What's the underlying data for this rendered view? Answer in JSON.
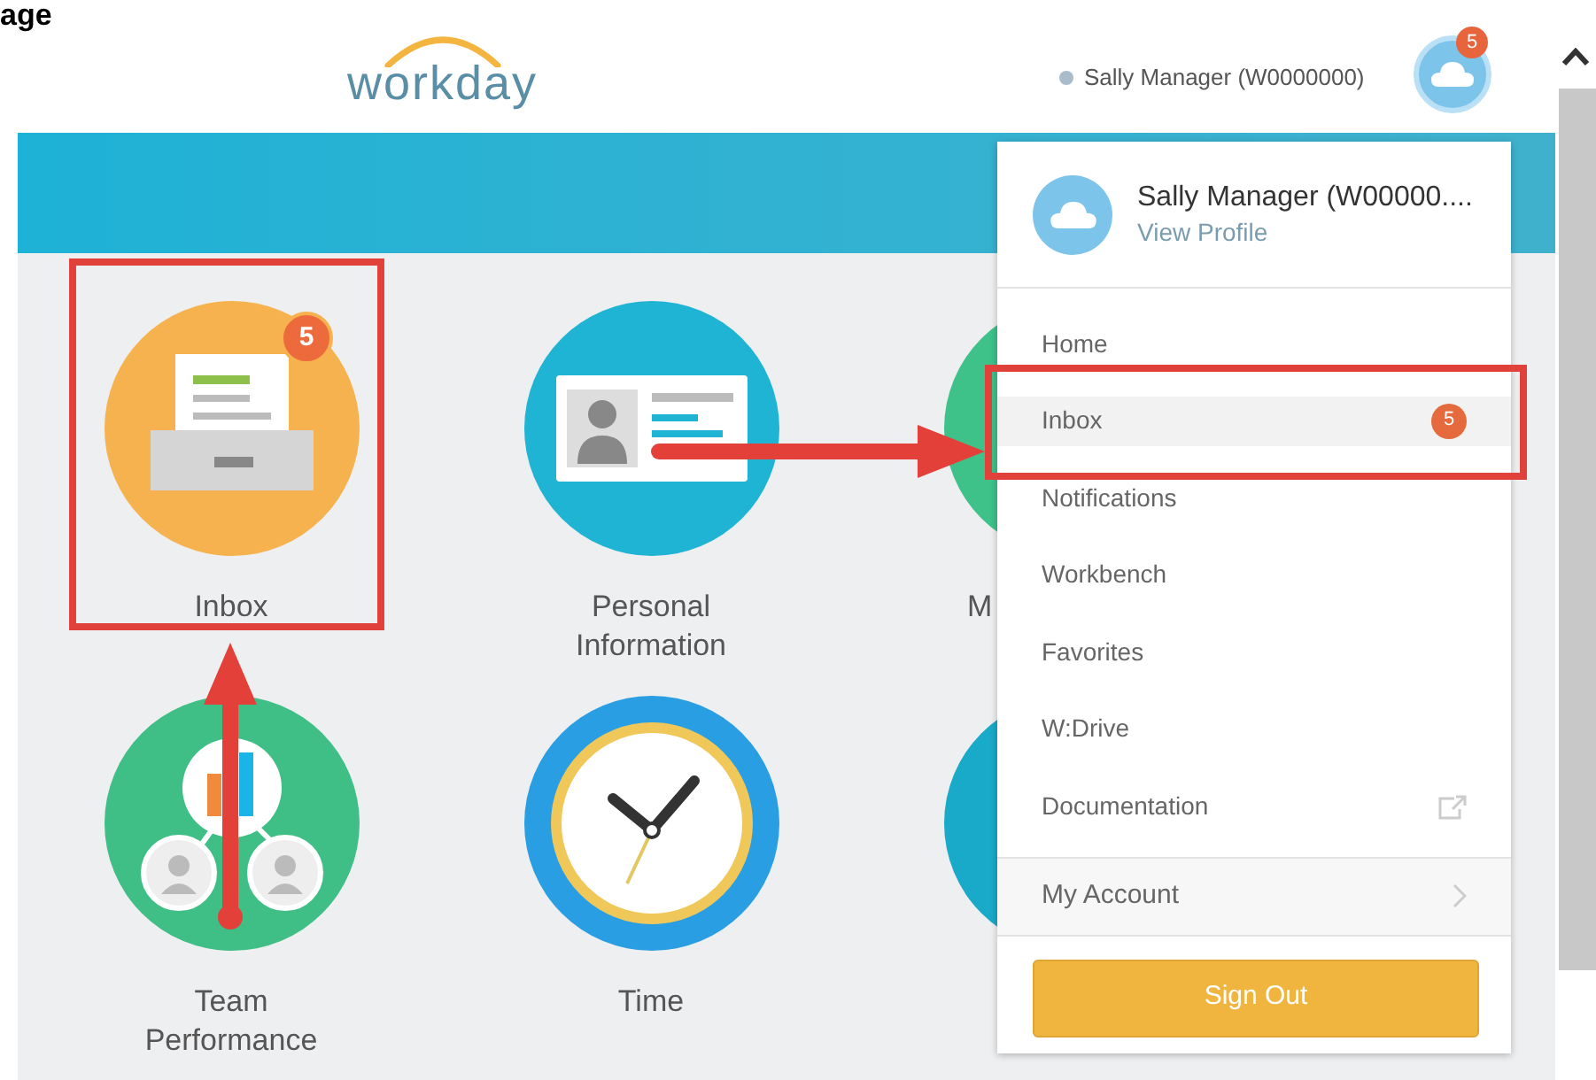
{
  "heading": "age",
  "logo": "workday",
  "user": {
    "name": "Sally Manager (W0000000)",
    "badge": "5"
  },
  "tiles": [
    {
      "kind": "inbox",
      "label": "Inbox",
      "badge": "5"
    },
    {
      "kind": "personal",
      "label": "Personal Information"
    },
    {
      "kind": "partial-green",
      "label": "M"
    },
    {
      "kind": "team",
      "label": "Team Performance"
    },
    {
      "kind": "time",
      "label": "Time"
    },
    {
      "kind": "partial-teal"
    }
  ],
  "menu": {
    "profile": {
      "name": "Sally Manager (W00000....",
      "link": "View Profile"
    },
    "items": [
      {
        "label": "Home",
        "selected": false
      },
      {
        "label": "Inbox",
        "selected": true,
        "badge": "5"
      },
      {
        "label": "Notifications",
        "selected": false
      },
      {
        "label": "Workbench",
        "selected": false
      },
      {
        "label": "Favorites",
        "selected": false
      },
      {
        "label": "W:Drive",
        "selected": false
      },
      {
        "label": "Documentation",
        "selected": false,
        "kind": "external"
      }
    ],
    "account": "My Account",
    "sign_out": "Sign Out"
  }
}
